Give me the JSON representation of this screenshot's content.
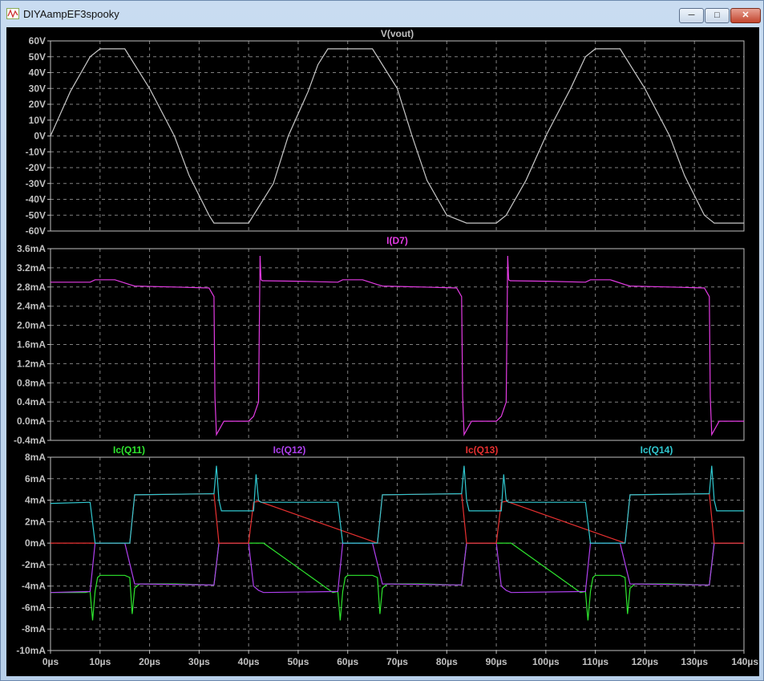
{
  "window": {
    "title": "DIYAampEF3spooky",
    "icon": "waveform-icon",
    "min_label": "─",
    "max_label": "□",
    "close_label": "✕"
  },
  "colors": {
    "background": "#000000",
    "grid": "#808080",
    "axis_text": "#c0c0c0",
    "vout": "#c8c8c8",
    "id7": "#e33be3",
    "q11": "#2ee62e",
    "q12": "#b040f0",
    "q13": "#e83030",
    "q14": "#30c8d0"
  },
  "chart_data": [
    {
      "type": "line",
      "title": "V(vout)",
      "xlim": [
        0,
        140
      ],
      "ylim": [
        -60,
        60
      ],
      "yticks": [
        "60V",
        "50V",
        "40V",
        "30V",
        "20V",
        "10V",
        "0V",
        "-10V",
        "-20V",
        "-30V",
        "-40V",
        "-50V",
        "-60V"
      ],
      "grid": true,
      "series": [
        {
          "name": "V(vout)",
          "color_key": "vout",
          "x": [
            0,
            4,
            8,
            10,
            12,
            15,
            20,
            25,
            28,
            32,
            33,
            35,
            40,
            45,
            48,
            52,
            54,
            56,
            60,
            65,
            70,
            73,
            76,
            80,
            84,
            88,
            90,
            92,
            96,
            100,
            105,
            108,
            110,
            112,
            115,
            120,
            125,
            128,
            132,
            134,
            136,
            140
          ],
          "y": [
            0,
            28,
            50,
            55,
            55,
            55,
            30,
            0,
            -25,
            -50,
            -55,
            -55,
            -55,
            -30,
            0,
            28,
            45,
            55,
            55,
            55,
            30,
            0,
            -28,
            -50,
            -55,
            -55,
            -55,
            -50,
            -28,
            0,
            30,
            50,
            55,
            55,
            55,
            30,
            0,
            -25,
            -50,
            -55,
            -55,
            -55
          ]
        }
      ]
    },
    {
      "type": "line",
      "title": "I(D7)",
      "xlim": [
        0,
        140
      ],
      "ylim": [
        -0.4,
        3.6
      ],
      "yticks": [
        "3.6mA",
        "3.2mA",
        "2.8mA",
        "2.4mA",
        "2.0mA",
        "1.6mA",
        "1.2mA",
        "0.8mA",
        "0.4mA",
        "0.0mA",
        "-0.4mA"
      ],
      "grid": true,
      "series": [
        {
          "name": "I(D7)",
          "color_key": "id7",
          "x": [
            0,
            8,
            9,
            13,
            16,
            17,
            25,
            32,
            33,
            33.2,
            33.5,
            35,
            40,
            41,
            42,
            42.3,
            42.5,
            42.8,
            43,
            50,
            58,
            59,
            63,
            66,
            67,
            75,
            82,
            83,
            83.2,
            83.5,
            85,
            90,
            91,
            92,
            92.3,
            92.5,
            92.8,
            93,
            100,
            108,
            109,
            113,
            116,
            117,
            125,
            132,
            133,
            133.2,
            133.5,
            135,
            140
          ],
          "y": [
            2.9,
            2.9,
            2.95,
            2.95,
            2.85,
            2.82,
            2.8,
            2.78,
            2.6,
            0.5,
            -0.28,
            0.0,
            0.0,
            0.1,
            0.4,
            3.45,
            2.95,
            2.93,
            2.93,
            2.92,
            2.9,
            2.95,
            2.95,
            2.85,
            2.82,
            2.8,
            2.78,
            2.6,
            0.5,
            -0.28,
            0.0,
            0.0,
            0.1,
            0.4,
            3.45,
            2.95,
            2.93,
            2.93,
            2.92,
            2.9,
            2.95,
            2.95,
            2.85,
            2.82,
            2.8,
            2.78,
            2.6,
            0.5,
            -0.28,
            0.0,
            0.0
          ]
        }
      ]
    },
    {
      "type": "line",
      "xlim": [
        0,
        140
      ],
      "ylim": [
        -10,
        8
      ],
      "yticks": [
        "8mA",
        "6mA",
        "4mA",
        "2mA",
        "0mA",
        "-2mA",
        "-4mA",
        "-6mA",
        "-8mA",
        "-10mA"
      ],
      "xticks": [
        "0µs",
        "10µs",
        "20µs",
        "30µs",
        "40µs",
        "50µs",
        "60µs",
        "70µs",
        "80µs",
        "90µs",
        "100µs",
        "110µs",
        "120µs",
        "130µs",
        "140µs"
      ],
      "grid": true,
      "series": [
        {
          "name": "Ic(Q11)",
          "color_key": "q11",
          "x": [
            0,
            7,
            8,
            8.5,
            9,
            9.5,
            10,
            15,
            16,
            16.5,
            17,
            18,
            25,
            33,
            34,
            43,
            57,
            58,
            58.5,
            59,
            59.5,
            60,
            65,
            66,
            66.5,
            67,
            68,
            75,
            83,
            84,
            93,
            107,
            108,
            108.5,
            109,
            109.5,
            110,
            115,
            116,
            116.5,
            117,
            118,
            125,
            133,
            134,
            140
          ],
          "y": [
            -4.6,
            -4.6,
            -4.5,
            -7.2,
            -4.5,
            -3.2,
            -3.0,
            -3.0,
            -3.2,
            -6.6,
            -4.2,
            -3.8,
            -3.8,
            -3.9,
            0,
            0,
            -4.6,
            -4.5,
            -7.2,
            -4.5,
            -3.2,
            -3.0,
            -3.0,
            -3.2,
            -6.6,
            -4.2,
            -3.8,
            -3.8,
            -3.9,
            0,
            0,
            -4.6,
            -4.5,
            -7.2,
            -4.5,
            -3.2,
            -3.0,
            -3.0,
            -3.2,
            -6.6,
            -4.2,
            -3.8,
            -3.8,
            -3.9,
            0,
            0
          ]
        },
        {
          "name": "Ic(Q12)",
          "color_key": "q12",
          "x": [
            0,
            8,
            9,
            15,
            17,
            33,
            34,
            40,
            41,
            42,
            43,
            58,
            59,
            65,
            67,
            83,
            84,
            90,
            91,
            92,
            93,
            108,
            109,
            115,
            117,
            133,
            134,
            140
          ],
          "y": [
            -4.6,
            -4.5,
            0,
            0,
            -3.8,
            -3.9,
            0,
            0,
            -4.0,
            -4.4,
            -4.6,
            -4.5,
            0,
            0,
            -3.8,
            -3.9,
            0,
            0,
            -4.0,
            -4.4,
            -4.6,
            -4.5,
            0,
            0,
            -3.8,
            -3.9,
            0,
            0
          ]
        },
        {
          "name": "Ic(Q13)",
          "color_key": "q13",
          "x": [
            0,
            16,
            17,
            33,
            34,
            35,
            40,
            41,
            42,
            66,
            67,
            83,
            84,
            85,
            90,
            91,
            92,
            116,
            117,
            133,
            134,
            135,
            140
          ],
          "y": [
            0,
            0,
            4.5,
            4.6,
            0,
            0,
            0,
            3.8,
            3.9,
            0,
            4.5,
            4.6,
            0,
            0,
            0,
            3.8,
            3.9,
            0,
            4.5,
            4.6,
            0,
            0,
            0
          ]
        },
        {
          "name": "Ic(Q14)",
          "color_key": "q14",
          "x": [
            0,
            8,
            9,
            16,
            17,
            33,
            33.5,
            34,
            34.5,
            35,
            41,
            41.5,
            42,
            42.5,
            43,
            58,
            59,
            66,
            67,
            83,
            83.5,
            84,
            84.5,
            85,
            91,
            91.5,
            92,
            92.5,
            93,
            108,
            109,
            116,
            117,
            133,
            133.5,
            134,
            134.5,
            135,
            140
          ],
          "y": [
            3.7,
            3.8,
            0,
            0,
            4.5,
            4.6,
            7.2,
            4.0,
            3.0,
            3.0,
            3.0,
            6.4,
            4.0,
            3.8,
            3.8,
            3.8,
            0,
            0,
            4.5,
            4.6,
            7.2,
            4.0,
            3.0,
            3.0,
            3.0,
            6.4,
            4.0,
            3.8,
            3.8,
            3.8,
            0,
            0,
            4.5,
            4.6,
            7.2,
            4.0,
            3.0,
            3.0,
            3.0
          ]
        }
      ]
    }
  ]
}
